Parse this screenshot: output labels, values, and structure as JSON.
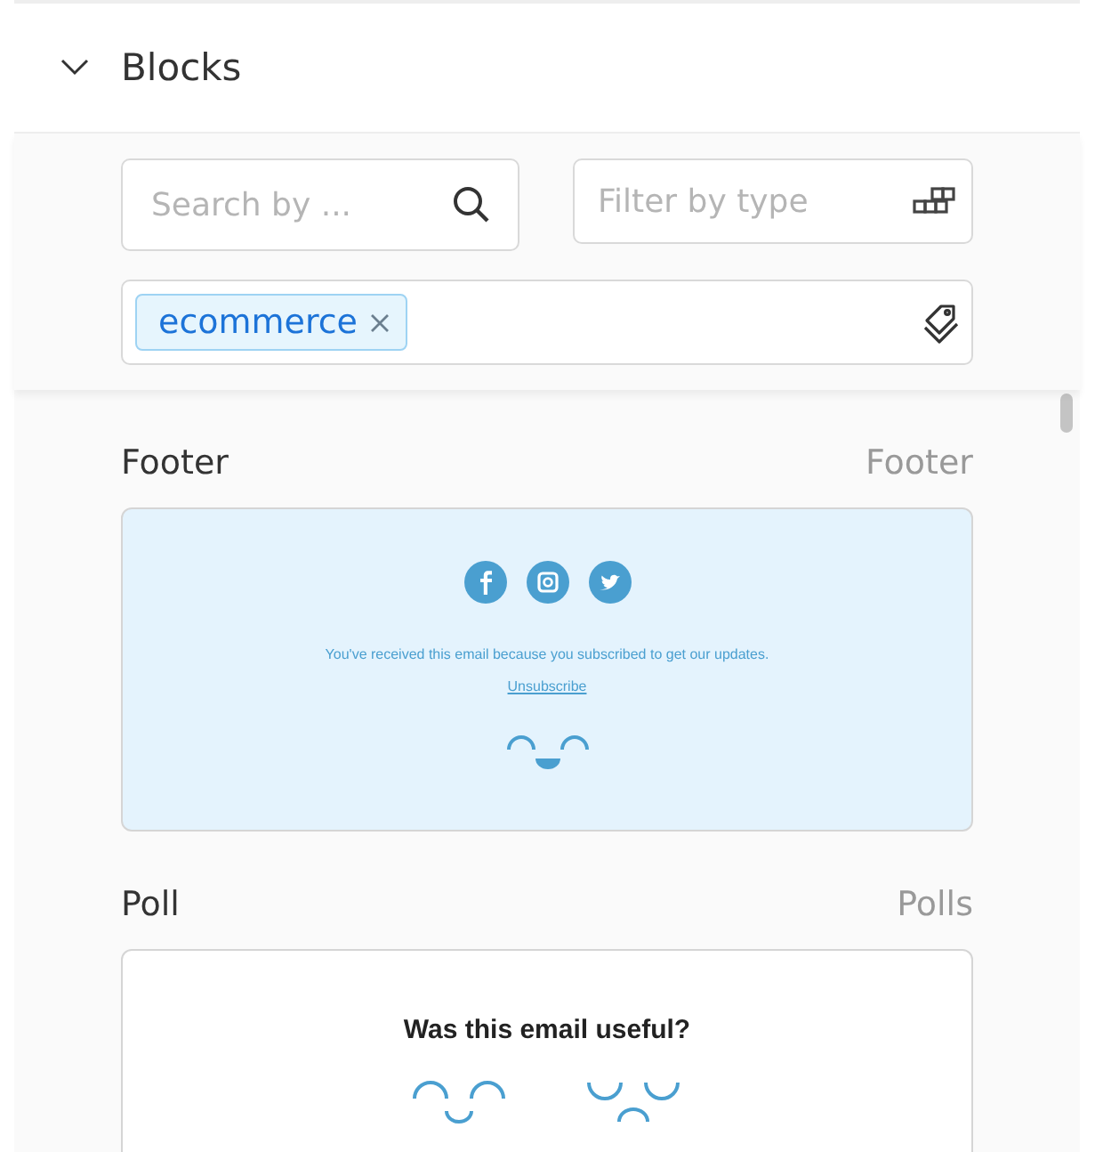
{
  "section": {
    "title": "Blocks",
    "expanded": true
  },
  "search": {
    "placeholder": "Search by ..."
  },
  "type_filter": {
    "placeholder": "Filter by type"
  },
  "tags": [
    "ecommerce"
  ],
  "blocks": [
    {
      "kind": "footer",
      "name": "Footer",
      "type": "Footer",
      "text": "You've received this email because you subscribed to get our updates.",
      "link": "Unsubscribe"
    },
    {
      "kind": "poll",
      "name": "Poll",
      "type": "Polls",
      "question": "Was this email useful?"
    }
  ]
}
